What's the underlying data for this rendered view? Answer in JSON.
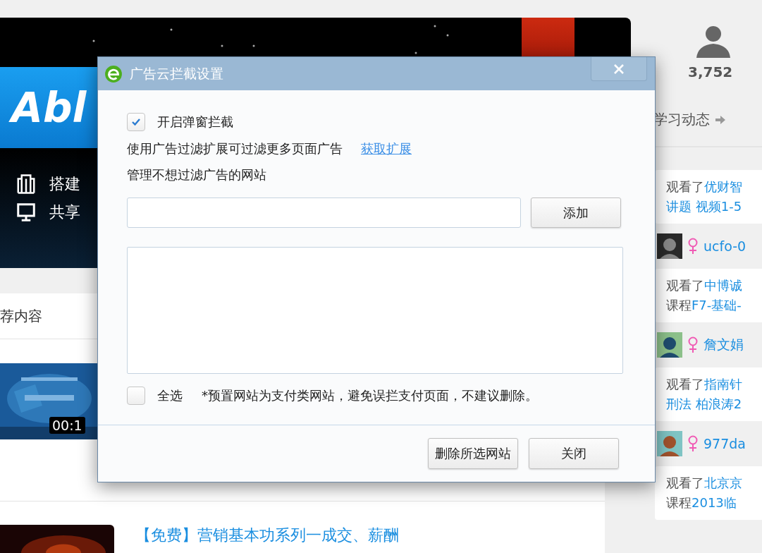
{
  "banner": {
    "logo": "Abl",
    "features": [
      {
        "kind": "building",
        "text": "搭建"
      },
      {
        "kind": "monitor",
        "text": "共享"
      }
    ]
  },
  "content": {
    "heading": "荐内容",
    "items": [
      {
        "duration": "00:1"
      },
      {
        "title": "【免费】营销基本功系列一成交、薪酬"
      }
    ]
  },
  "sidebar": {
    "count": "3,752",
    "section_title": "学习动态",
    "feed": [
      {
        "prefix": "观看了",
        "link": "优财智",
        "line2": "讲题 视频1-5",
        "user": "ucfo-0"
      },
      {
        "prefix": "观看了",
        "link": "中博诚",
        "line2_prefix": "课程",
        "line2": "F7-基础-",
        "user": "詹文娟",
        "kind": "cartoon-teal"
      },
      {
        "prefix": "观看了",
        "link": "指南针",
        "line2": "刑法 柏浪涛2",
        "user": "977da",
        "kind": "cartoon-brown"
      },
      {
        "prefix": "观看了",
        "link": "北京京",
        "line2_prefix": "课程",
        "line2": "2013临"
      }
    ]
  },
  "dialog": {
    "title": "广告云拦截设置",
    "enable_checkbox": {
      "label": "开启弹窗拦截",
      "checked": true
    },
    "extension_text": "使用广告过滤扩展可过滤更多页面广告",
    "extension_link": "获取扩展",
    "manage_label": "管理不想过滤广告的网站",
    "add_button": "添加",
    "select_all": {
      "label": "全选",
      "checked": false
    },
    "note": "*预置网站为支付类网站，避免误拦支付页面，不建议删除。",
    "buttons": [
      "删除所选网站",
      "关闭"
    ]
  }
}
